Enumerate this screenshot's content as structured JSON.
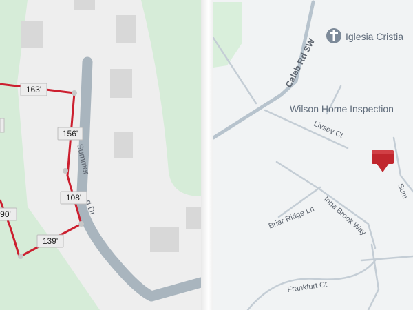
{
  "parcel_map": {
    "road_label": "Summer",
    "road_label_continued": "d Dr",
    "dimensions": [
      "163'",
      "156'",
      "108'",
      "139'",
      "90'"
    ]
  },
  "street_map": {
    "roads": {
      "caleb": "Caleb Rd SW",
      "livsey": "Livsey Ct",
      "briar": "Briar Ridge Ln",
      "inna": "Inna Brook Way",
      "frankfurt": "Frankfurt Ct",
      "summer_partial": "Sum"
    },
    "pois": {
      "church": "Iglesia Cristia",
      "business": "Wilson Home Inspection"
    },
    "marker_color": "#c0262d",
    "icons": [
      "church-cross-icon",
      "location-marker-icon"
    ]
  }
}
